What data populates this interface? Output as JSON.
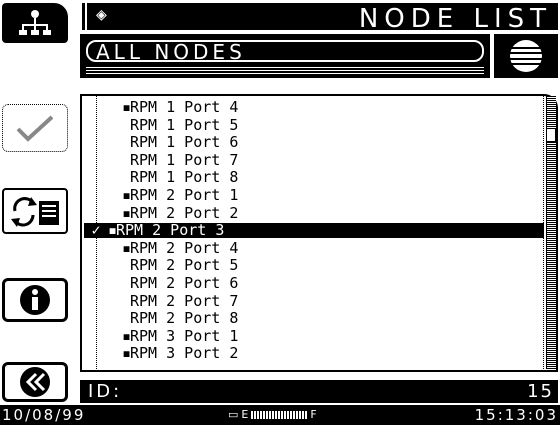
{
  "header": {
    "title": "NODE LIST",
    "filter_label": "ALL NODES"
  },
  "list": {
    "items": [
      {
        "label": "RPM 1 Port 4",
        "bullet": true,
        "selected": false
      },
      {
        "label": "RPM 1 Port 5",
        "bullet": false,
        "selected": false
      },
      {
        "label": "RPM 1 Port 6",
        "bullet": false,
        "selected": false
      },
      {
        "label": "RPM 1 Port 7",
        "bullet": false,
        "selected": false
      },
      {
        "label": "RPM 1 Port 8",
        "bullet": false,
        "selected": false
      },
      {
        "label": "RPM 2 Port 1",
        "bullet": true,
        "selected": false
      },
      {
        "label": "RPM 2 Port 2",
        "bullet": true,
        "selected": false
      },
      {
        "label": "RPM 2 Port 3",
        "bullet": true,
        "selected": true
      },
      {
        "label": "RPM 2 Port 4",
        "bullet": true,
        "selected": false
      },
      {
        "label": "RPM 2 Port 5",
        "bullet": false,
        "selected": false
      },
      {
        "label": "RPM 2 Port 6",
        "bullet": false,
        "selected": false
      },
      {
        "label": "RPM 2 Port 7",
        "bullet": false,
        "selected": false
      },
      {
        "label": "RPM 2 Port 8",
        "bullet": false,
        "selected": false
      },
      {
        "label": "RPM 3 Port 1",
        "bullet": true,
        "selected": false
      },
      {
        "label": "RPM 3 Port 2",
        "bullet": true,
        "selected": false
      }
    ]
  },
  "id_bar": {
    "label": "ID:",
    "value": "15"
  },
  "status": {
    "date": "10/08/99",
    "time": "15:13:03",
    "battery_empty": "E",
    "battery_full": "F"
  },
  "icons": {
    "network": "network-tree-icon",
    "check": "checkmark-icon",
    "refresh": "refresh-document-icon",
    "info": "info-icon",
    "back": "double-chevron-left-icon",
    "globe": "globe-icon"
  }
}
